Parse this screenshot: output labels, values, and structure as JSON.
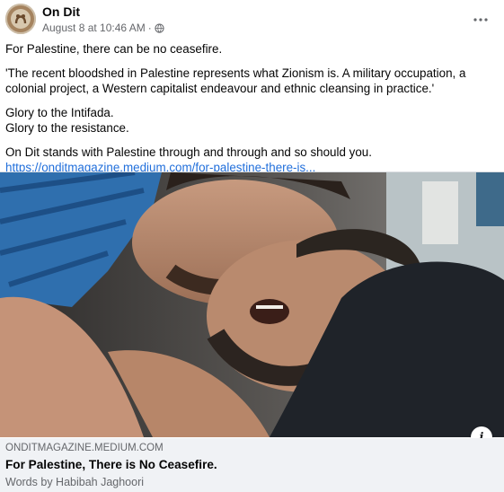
{
  "post": {
    "page_name": "On Dit",
    "timestamp": "August 8 at 10:46 AM",
    "separator": "·",
    "privacy_icon": "globe-icon",
    "more_icon": "more-horizontal-icon",
    "text": {
      "line1": "For Palestine, there can be no ceasefire.",
      "quote": "'The recent bloodshed in Palestine represents what Zionism is. A military occupation, a colonial project, a Western capitalist endeavour and ethnic cleansing in practice.'",
      "glory1": "Glory to the Intifada.",
      "glory2": "Glory to the resistance.",
      "stand": "On Dit stands with Palestine through and through and so should you.",
      "link": "https://onditmagazine.medium.com/for-palestine-there-is..."
    }
  },
  "link_card": {
    "domain": "ONDITMAGAZINE.MEDIUM.COM",
    "title": "For Palestine, There is No Ceasefire.",
    "subtitle": "Words by Habibah Jaghoori",
    "info_icon": "info-icon",
    "info_glyph": "i"
  }
}
